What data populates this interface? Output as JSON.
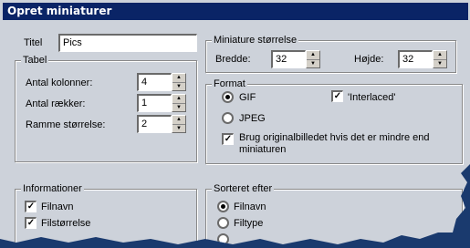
{
  "window": {
    "title": "Opret miniaturer"
  },
  "title_field": {
    "label": "Titel",
    "value": "Pics"
  },
  "tabel": {
    "legend": "Tabel",
    "columns": {
      "label": "Antal kolonner:",
      "value": "4"
    },
    "rows": {
      "label": "Antal rækker:",
      "value": "1"
    },
    "frame": {
      "label": "Ramme størrelse:",
      "value": "2"
    }
  },
  "size": {
    "legend": "Miniature størrelse",
    "width": {
      "label": "Bredde:",
      "value": "32"
    },
    "height": {
      "label": "Højde:",
      "value": "32"
    }
  },
  "format": {
    "legend": "Format",
    "gif": "GIF",
    "jpeg": "JPEG",
    "interlaced": "'Interlaced'",
    "use_original_line1": "Brug originalbilledet hvis det er mindre end",
    "use_original_line2": "miniaturen"
  },
  "info": {
    "legend": "Informationer",
    "filename": "Filnavn",
    "filesize": "Filstørrelse"
  },
  "sort": {
    "legend": "Sorteret efter",
    "filename": "Filnavn",
    "filetype": "Filtype"
  }
}
